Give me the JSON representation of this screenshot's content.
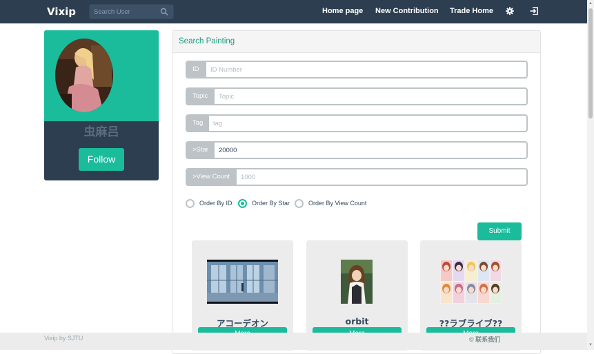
{
  "navbar": {
    "brand": "Vixip",
    "search_placeholder": "Search User",
    "links": [
      "Home page",
      "New Contribution",
      "Trade Home"
    ],
    "icons": [
      "gear-icon",
      "sign-out-icon",
      "search-icon"
    ]
  },
  "profile": {
    "username": "虫麻吕",
    "follow_label": "Follow"
  },
  "search_panel": {
    "title": "Search Painting",
    "fields": [
      {
        "label": "ID",
        "placeholder": "ID Number",
        "value": ""
      },
      {
        "label": "Topic",
        "placeholder": "Topic",
        "value": ""
      },
      {
        "label": "Tag",
        "placeholder": "tag",
        "value": ""
      },
      {
        "label": ">Star",
        "placeholder": "",
        "value": "20000"
      },
      {
        "label": ">View Count",
        "placeholder": "1000",
        "value": ""
      }
    ],
    "order_options": [
      {
        "label": "Order By ID",
        "checked": false
      },
      {
        "label": "Order By Star",
        "checked": true
      },
      {
        "label": "Order By View Count",
        "checked": false
      }
    ],
    "submit_label": "Submit"
  },
  "cards": [
    {
      "title": "アコーデオン",
      "more_label": "More"
    },
    {
      "title": "orbit",
      "more_label": "More"
    },
    {
      "title": "??ラブライブ??",
      "more_label": "More"
    }
  ],
  "footer": {
    "left": "Vixip by SJTU",
    "right": "© 联系我们"
  },
  "colors": {
    "navbar": "#2c3e50",
    "accent": "#1abc9c",
    "addon": "#bdc3c7"
  }
}
